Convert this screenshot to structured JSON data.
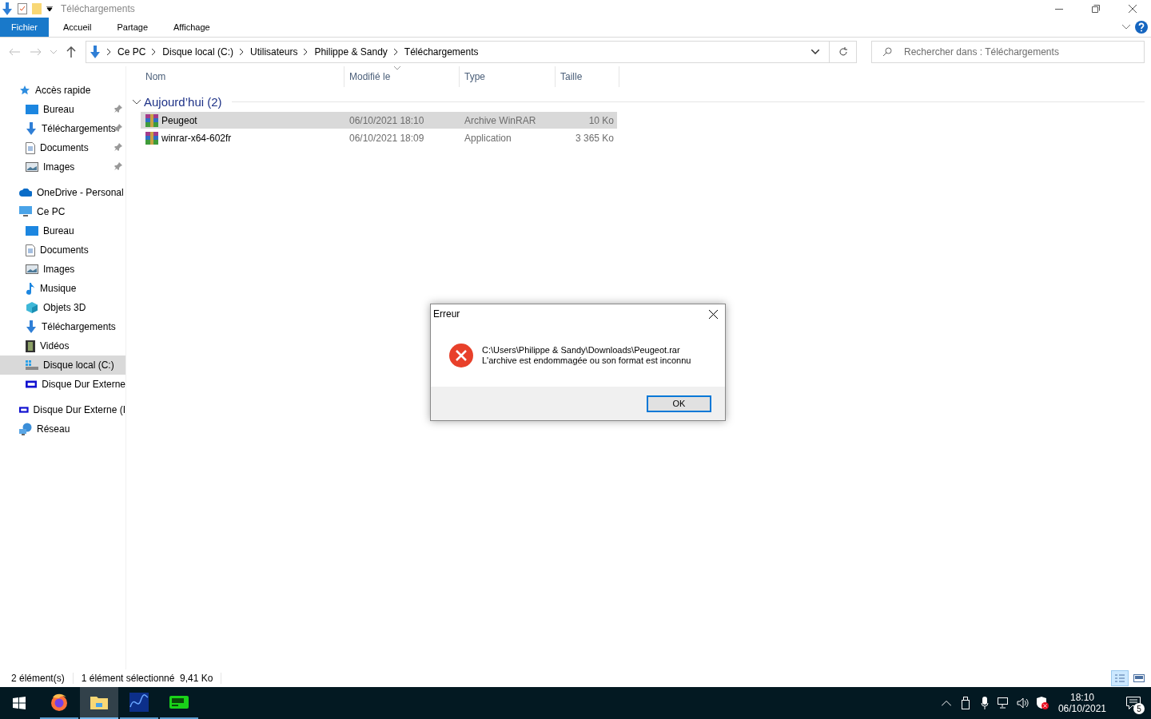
{
  "window": {
    "title": "Téléchargements"
  },
  "ribbon_tabs": [
    {
      "label": "Fichier",
      "selected": true
    },
    {
      "label": "Accueil",
      "selected": false
    },
    {
      "label": "Partage",
      "selected": false
    },
    {
      "label": "Affichage",
      "selected": false
    }
  ],
  "breadcrumb": [
    "Ce PC",
    "Disque local (C:)",
    "Utilisateurs",
    "Philippe & Sandy",
    "Téléchargements"
  ],
  "search": {
    "placeholder": "Rechercher dans : Téléchargements"
  },
  "sidebar": {
    "items": [
      {
        "label": "Accès rapide",
        "selected": false,
        "children": [
          {
            "label": "Bureau",
            "pinned": true,
            "selected": false
          },
          {
            "label": "Téléchargements",
            "pinned": true,
            "selected": false
          },
          {
            "label": "Documents",
            "pinned": true,
            "selected": false
          },
          {
            "label": "Images",
            "pinned": true,
            "selected": false
          }
        ]
      },
      {
        "label": "OneDrive - Personal",
        "selected": false
      },
      {
        "label": "Ce PC",
        "selected": false,
        "children": [
          {
            "label": "Bureau",
            "pinned": false,
            "selected": false
          },
          {
            "label": "Documents",
            "pinned": false,
            "selected": false
          },
          {
            "label": "Images",
            "pinned": false,
            "selected": false
          },
          {
            "label": "Musique",
            "pinned": false,
            "selected": false
          },
          {
            "label": "Objets 3D",
            "pinned": false,
            "selected": false
          },
          {
            "label": "Téléchargements",
            "pinned": false,
            "selected": false
          },
          {
            "label": "Vidéos",
            "pinned": false,
            "selected": false
          },
          {
            "label": "Disque local (C:)",
            "pinned": false,
            "selected": true
          },
          {
            "label": "Disque Dur Externe",
            "pinned": false,
            "selected": false
          }
        ]
      },
      {
        "label": "Disque Dur Externe (I",
        "selected": false
      },
      {
        "label": "Réseau",
        "selected": false
      }
    ]
  },
  "table": {
    "columns": [
      "Nom",
      "Modifié le",
      "Type",
      "Taille"
    ],
    "group": {
      "label": "Aujourd’hui (2)",
      "expanded": true
    },
    "rows": [
      {
        "name": "Peugeot",
        "modified": "06/10/2021 18:10",
        "type": "Archive WinRAR",
        "size": "10 Ko",
        "selected": true
      },
      {
        "name": "winrar-x64-602fr",
        "modified": "06/10/2021 18:09",
        "type": "Application",
        "size": "3 365 Ko",
        "selected": false
      }
    ]
  },
  "status_bar": {
    "count": "2 élément(s)",
    "selection": "1 élément sélectionné  9,41 Ko"
  },
  "dialog": {
    "title": "Erreur",
    "lines": [
      "C:\\Users\\Philippe & Sandy\\Downloads\\Peugeot.rar",
      "L'archive est endommagée ou son format est inconnu"
    ],
    "button": "OK"
  },
  "taskbar": {
    "apps": [
      {
        "kind": "firefox",
        "active": false
      },
      {
        "kind": "explorer",
        "active": true
      },
      {
        "kind": "wave",
        "active": false
      },
      {
        "kind": "meter",
        "active": false
      }
    ],
    "time": "18:10",
    "date": "06/10/2021",
    "notifications": "5"
  }
}
